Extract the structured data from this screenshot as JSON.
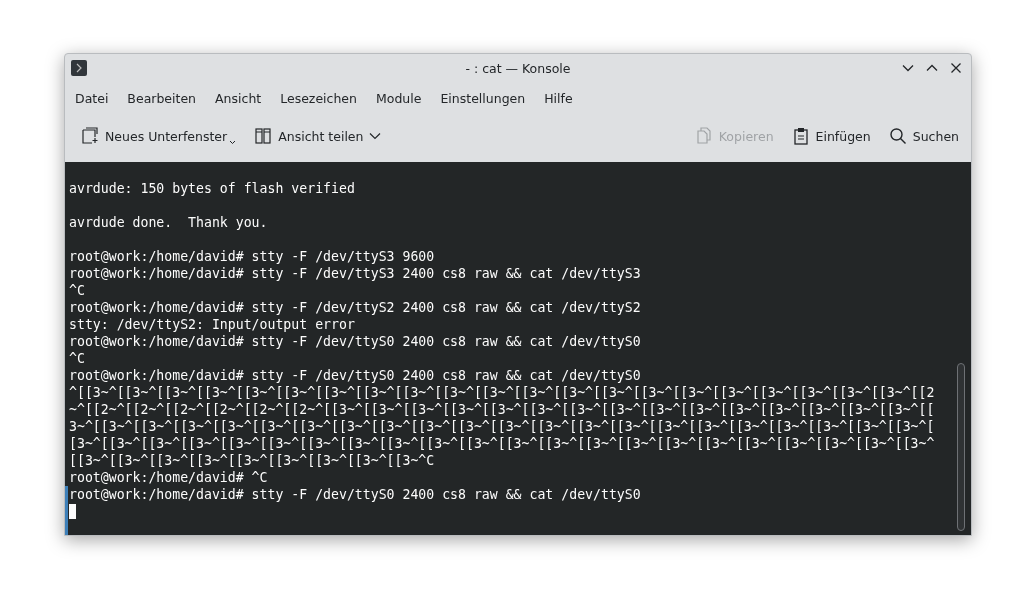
{
  "window": {
    "title": "- : cat — Konsole"
  },
  "menu": [
    "Datei",
    "Bearbeiten",
    "Ansicht",
    "Lesezeichen",
    "Module",
    "Einstellungen",
    "Hilfe"
  ],
  "toolbar": [
    {
      "kind": "new-tab",
      "label": "Neues Unterfenster",
      "disabled": false
    },
    {
      "kind": "split",
      "label": "Ansicht teilen",
      "disabled": false
    },
    {
      "kind": "copy",
      "label": "Kopieren",
      "disabled": true
    },
    {
      "kind": "paste",
      "label": "Einfügen",
      "disabled": false
    },
    {
      "kind": "search",
      "label": "Suchen",
      "disabled": false
    }
  ],
  "terminal": {
    "blocks": [
      [
        "avrdude: 150 bytes of flash verified"
      ],
      [
        "avrdude done.  Thank you."
      ],
      [
        "root@work:/home/david# stty -F /dev/ttyS3 9600",
        "root@work:/home/david# stty -F /dev/ttyS3 2400 cs8 raw && cat /dev/ttyS3",
        "^C",
        "root@work:/home/david# stty -F /dev/ttyS2 2400 cs8 raw && cat /dev/ttyS2",
        "stty: /dev/ttyS2: Input/output error",
        "root@work:/home/david# stty -F /dev/ttyS0 2400 cs8 raw && cat /dev/ttyS0",
        "^C",
        "root@work:/home/david# stty -F /dev/ttyS0 2400 cs8 raw && cat /dev/ttyS0",
        "^[[3~^[[3~^[[3~^[[3~^[[3~^[[3~^[[3~^[[3~^[[3~^[[3~^[[3~^[[3~^[[3~^[[3~^[[3~^[[3~^[[3~^[[3~^[[3~^[[3~^[[3~^[[2",
        "~^[[2~^[[2~^[[2~^[[2~^[[2~^[[2~^[[3~^[[3~^[[3~^[[3~^[[3~^[[3~^[[3~^[[3~^[[3~^[[3~^[[3~^[[3~^[[3~^[[3~^[[3~^[[",
        "3~^[[3~^[[3~^[[3~^[[3~^[[3~^[[3~^[[3~^[[3~^[[3~^[[3~^[[3~^[[3~^[[3~^[[3~^[[3~^[[3~^[[3~^[[3~^[[3~^[[3~^[[3~^[",
        "[3~^[[3~^[[3~^[[3~^[[3~^[[3~^[[3~^[[3~^[[3~^[[3~^[[3~^[[3~^[[3~^[[3~^[[3~^[[3~^[[3~^[[3~^[[3~^[[3~^[[3~^[[3~^",
        "[[3~^[[3~^[[3~^[[3~^[[3~^[[3~^[[3~^[[3~^[[3~^C",
        "root@work:/home/david# ^C",
        "root@work:/home/david# stty -F /dev/ttyS0 2400 cs8 raw && cat /dev/ttyS0"
      ]
    ]
  }
}
